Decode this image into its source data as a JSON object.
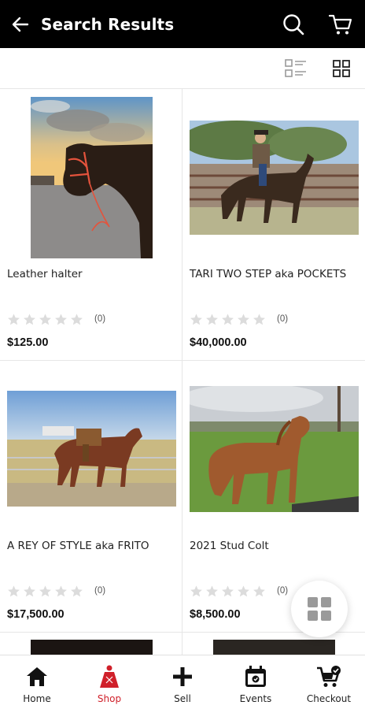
{
  "header": {
    "title": "Search Results",
    "back_icon": "arrow-left-icon",
    "search_icon": "search-icon",
    "cart_icon": "cart-icon",
    "background": "#000000"
  },
  "view_toggle": {
    "list_icon": "list-view-icon",
    "grid_icon": "grid-view-icon",
    "selected": "grid"
  },
  "products": [
    {
      "name": "Leather halter",
      "rating": 0,
      "review_count": "(0)",
      "price": "$125.00"
    },
    {
      "name": "TARI TWO STEP aka POCKETS",
      "rating": 0,
      "review_count": "(0)",
      "price": "$40,000.00"
    },
    {
      "name": "A REY OF STYLE aka FRITO",
      "rating": 0,
      "review_count": "(0)",
      "price": "$17,500.00"
    },
    {
      "name": "2021 Stud Colt",
      "rating": 0,
      "review_count": "(0)",
      "price": "$8,500.00"
    }
  ],
  "bottom_nav": {
    "active": "Shop",
    "accent": "#d0202a",
    "items": [
      {
        "label": "Home",
        "icon": "home-icon"
      },
      {
        "label": "Shop",
        "icon": "shop-icon"
      },
      {
        "label": "Sell",
        "icon": "plus-icon"
      },
      {
        "label": "Events",
        "icon": "calendar-icon"
      },
      {
        "label": "Checkout",
        "icon": "cart-check-icon"
      }
    ]
  },
  "fab": {
    "icon": "grid-menu-icon"
  }
}
